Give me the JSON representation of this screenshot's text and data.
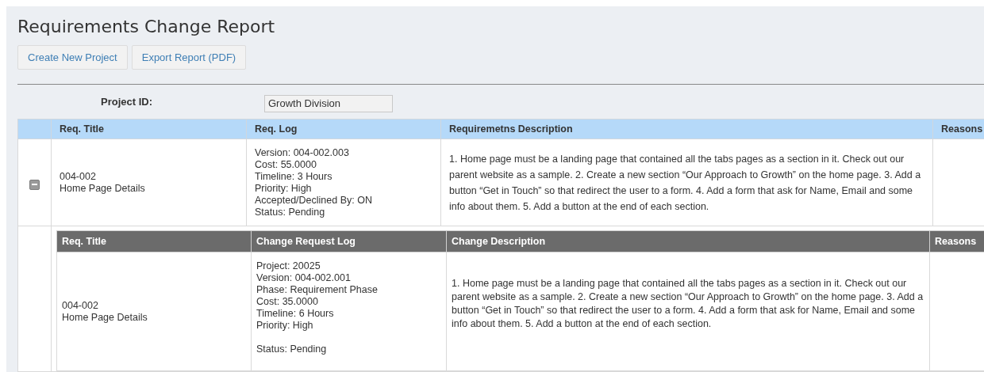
{
  "title": "Requirements Change Report",
  "buttons": [
    "Create New Project",
    "Export Report (PDF)"
  ],
  "project_id": {
    "label": "Project ID:",
    "value": "Growth Division"
  },
  "table": {
    "columns": [
      "Req. Title",
      "Req. Log",
      "Requiremetns Description",
      "Reasons"
    ],
    "rows": [
      {
        "expanded": true,
        "title_lines": [
          "004-002",
          "Home Page Details"
        ],
        "log": [
          {
            "text": "Version: 004-002.003",
            "gap_before": false
          },
          {
            "text": "Cost: 55.0000",
            "gap_before": false
          },
          {
            "text": "Timeline: 3 Hours",
            "gap_before": false
          },
          {
            "text": "Priority: High",
            "gap_before": false
          },
          {
            "text": "Accepted/Declined By: ON",
            "gap_before": false
          },
          {
            "text": "Status: Pending",
            "gap_before": false
          }
        ],
        "description": "1. Home page must be a landing page that contained all the tabs pages as a section in it. Check out our parent website as a sample. 2. Create a new section “Our Approach to Growth” on the home page. 3. Add a button “Get in Touch” so that redirect the user to a form. 4. Add a form that ask for Name, Email and some info about them. 5. Add a button at the end of each section.",
        "changes": {
          "columns": [
            "Req. Title",
            "Change Request Log",
            "Change Description",
            "Reasons"
          ],
          "rows": [
            {
              "title_lines": [
                "004-002",
                "Home Page Details"
              ],
              "log": [
                {
                  "text": "Project: 20025",
                  "gap_before": false
                },
                {
                  "text": "Version: 004-002.001",
                  "gap_before": false
                },
                {
                  "text": "Phase: Requirement Phase",
                  "gap_before": false
                },
                {
                  "text": "Cost: 35.0000",
                  "gap_before": false
                },
                {
                  "text": "Timeline: 6 Hours",
                  "gap_before": false
                },
                {
                  "text": "Priority: High",
                  "gap_before": false
                },
                {
                  "text": "Status: Pending",
                  "gap_before": true
                }
              ],
              "description": "1. Home page must be a landing page that contained all the tabs pages as a section in it. Check out our parent website as a sample. 2. Create a new section “Our Approach to Growth” on the home page. 3. Add a button “Get in Touch” so that redirect the user to a form. 4. Add a form that ask for Name, Email and some info about them. 5. Add a button at the end of each section."
            }
          ]
        }
      }
    ]
  }
}
